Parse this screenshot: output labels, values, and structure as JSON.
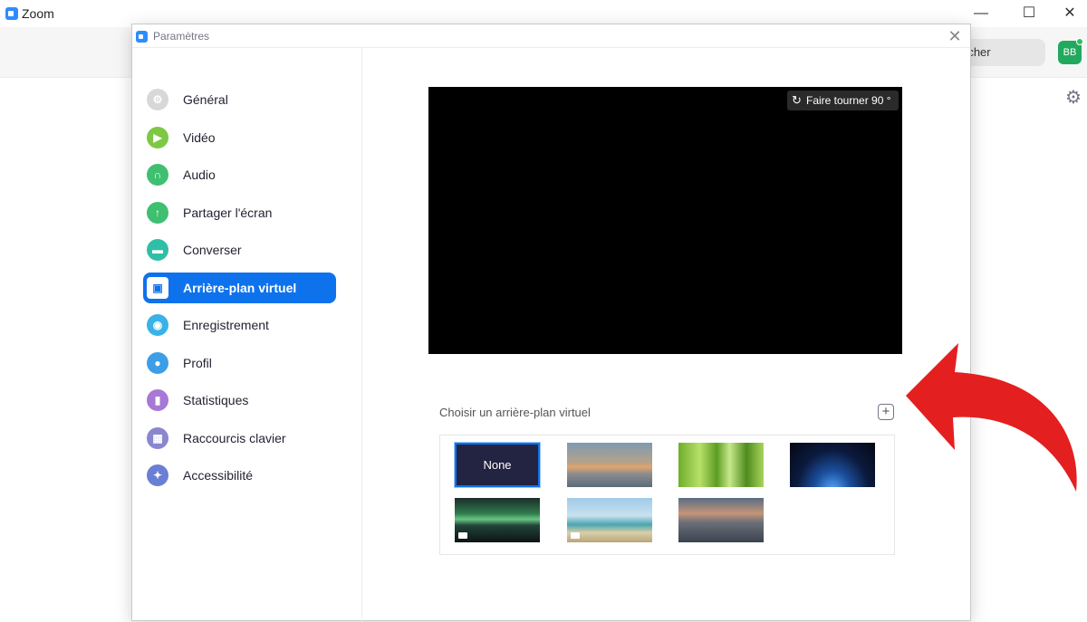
{
  "app": {
    "title": "Zoom",
    "search_text": "rcher",
    "avatar_initials": "BB"
  },
  "window_controls": {
    "minimize": "—",
    "maximize": "☐",
    "close": "✕"
  },
  "dialog": {
    "title": "Paramètres",
    "close_glyph": "✕"
  },
  "sidebar": {
    "items": [
      {
        "label": "Général",
        "icon": "gear-icon",
        "color": "#d8d8d8",
        "glyph": "⚙"
      },
      {
        "label": "Vidéo",
        "icon": "video-camera-icon",
        "color": "#7ec843",
        "glyph": "▶"
      },
      {
        "label": "Audio",
        "icon": "headphones-icon",
        "color": "#3fbf70",
        "glyph": "∩"
      },
      {
        "label": "Partager l'écran",
        "icon": "share-screen-icon",
        "color": "#3fbf70",
        "glyph": "↑"
      },
      {
        "label": "Converser",
        "icon": "chat-icon",
        "color": "#2fbfa6",
        "glyph": "▬"
      },
      {
        "label": "Arrière-plan virtuel",
        "icon": "virtual-background-icon",
        "color": "#ffffff",
        "glyph": "▣",
        "active": true
      },
      {
        "label": "Enregistrement",
        "icon": "record-icon",
        "color": "#39b3e6",
        "glyph": "◉"
      },
      {
        "label": "Profil",
        "icon": "profile-icon",
        "color": "#3d9ee8",
        "glyph": "●"
      },
      {
        "label": "Statistiques",
        "icon": "statistics-icon",
        "color": "#a878d6",
        "glyph": "▮"
      },
      {
        "label": "Raccourcis clavier",
        "icon": "keyboard-icon",
        "color": "#8a86cf",
        "glyph": "▦"
      },
      {
        "label": "Accessibilité",
        "icon": "accessibility-icon",
        "color": "#6a7fd3",
        "glyph": "✦"
      }
    ]
  },
  "preview": {
    "rotate_label": "Faire tourner 90 °",
    "rotate_icon": "↻"
  },
  "backgrounds": {
    "label": "Choisir un arrière-plan virtuel",
    "add_glyph": "+",
    "items": [
      {
        "name": "None",
        "style": "none-thumb",
        "selected": true,
        "video": false
      },
      {
        "name": "golden-gate-bridge",
        "style": "bridge",
        "selected": false,
        "video": false
      },
      {
        "name": "grass",
        "style": "grass",
        "selected": false,
        "video": false
      },
      {
        "name": "earth-from-space",
        "style": "earth",
        "selected": false,
        "video": false
      },
      {
        "name": "aurora",
        "style": "aurora",
        "selected": false,
        "video": true
      },
      {
        "name": "beach-palm",
        "style": "beach",
        "selected": false,
        "video": true
      },
      {
        "name": "lake-sunset",
        "style": "lake",
        "selected": false,
        "video": false
      }
    ]
  },
  "colors": {
    "accent": "#0e72ed",
    "arrow": "#e41f1f"
  }
}
